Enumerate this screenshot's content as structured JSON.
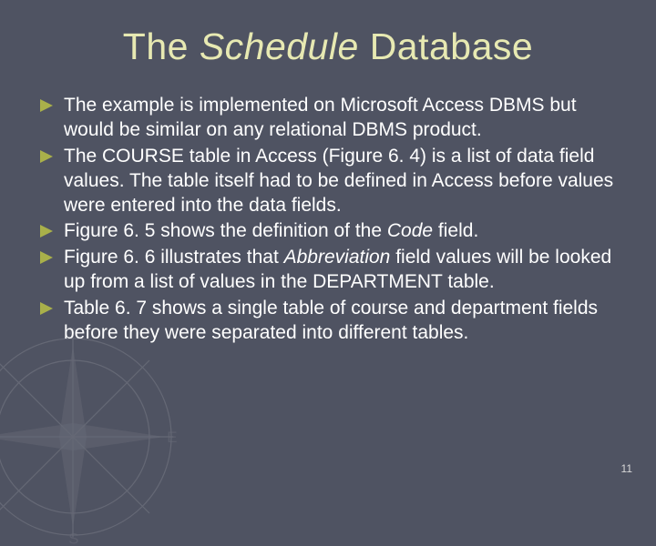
{
  "title": {
    "pre": "The ",
    "em": "Schedule",
    "post": " Database"
  },
  "bullets": [
    {
      "segments": [
        {
          "t": "The example is implemented on Microsoft Access DBMS but would be similar on any relational DBMS product."
        }
      ]
    },
    {
      "segments": [
        {
          "t": "The COURSE table in Access (Figure 6. 4) is a list of data field values.  The table itself had to be defined in Access before values were entered into the data fields."
        }
      ]
    },
    {
      "segments": [
        {
          "t": "Figure 6. 5 shows the definition of the "
        },
        {
          "t": "Code",
          "em": true
        },
        {
          "t": " field."
        }
      ]
    },
    {
      "segments": [
        {
          "t": "Figure 6. 6 illustrates that "
        },
        {
          "t": "Abbreviation",
          "em": true
        },
        {
          "t": " field values will be looked up from a list of values in the DEPARTMENT table."
        }
      ]
    },
    {
      "segments": [
        {
          "t": "Table 6. 7 shows a single table of course and department fields before they were separated into different tables."
        }
      ]
    }
  ],
  "page_number": "11"
}
